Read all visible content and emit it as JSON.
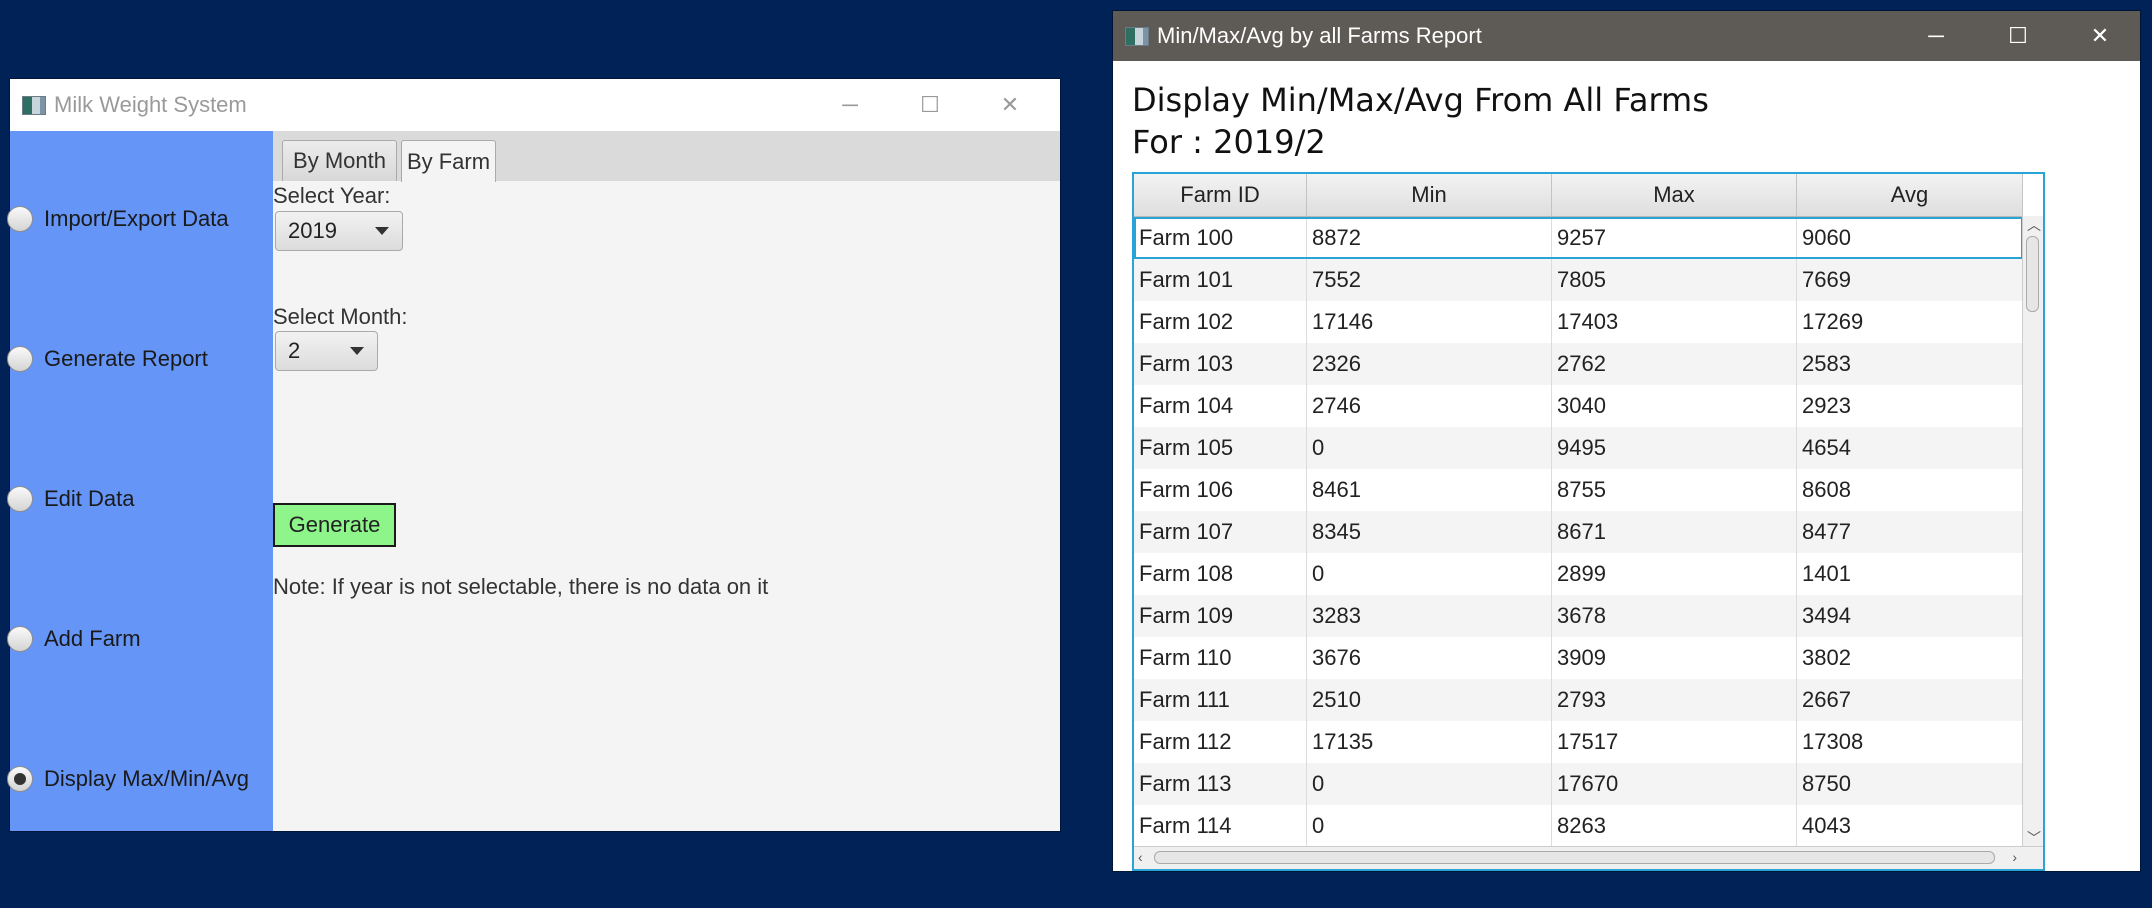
{
  "main_window": {
    "title": "Milk Weight System",
    "controls": {
      "minimize": "─",
      "maximize": "☐",
      "close": "✕"
    },
    "sidebar": {
      "items": [
        {
          "label": "Import/Export Data",
          "selected": false
        },
        {
          "label": "Generate Report",
          "selected": false
        },
        {
          "label": "Edit Data",
          "selected": false
        },
        {
          "label": "Add Farm",
          "selected": false
        },
        {
          "label": "Display Max/Min/Avg",
          "selected": true
        }
      ]
    },
    "tabs": [
      {
        "label": "By Month",
        "selected": false
      },
      {
        "label": "By Farm",
        "selected": true
      }
    ],
    "form": {
      "year_label": "Select Year:",
      "year_value": "2019",
      "month_label": "Select Month:",
      "month_value": "2",
      "generate_label": "Generate",
      "note": "Note: If year is not selectable, there is no data on it"
    },
    "colors": {
      "sidebar": "#6495f7",
      "generate_button": "#8df58a"
    }
  },
  "report_window": {
    "title": "Min/Max/Avg by all Farms Report",
    "controls": {
      "minimize": "─",
      "maximize": "☐",
      "close": "✕"
    },
    "heading_line1": "Display Min/Max/Avg From All Farms",
    "heading_line2": "For : 2019/2",
    "table": {
      "columns": [
        "Farm ID",
        "Min",
        "Max",
        "Avg"
      ],
      "rows": [
        [
          "Farm 100",
          "8872",
          "9257",
          "9060"
        ],
        [
          "Farm 101",
          "7552",
          "7805",
          "7669"
        ],
        [
          "Farm 102",
          "17146",
          "17403",
          "17269"
        ],
        [
          "Farm 103",
          "2326",
          "2762",
          "2583"
        ],
        [
          "Farm 104",
          "2746",
          "3040",
          "2923"
        ],
        [
          "Farm 105",
          "0",
          "9495",
          "4654"
        ],
        [
          "Farm 106",
          "8461",
          "8755",
          "8608"
        ],
        [
          "Farm 107",
          "8345",
          "8671",
          "8477"
        ],
        [
          "Farm 108",
          "0",
          "2899",
          "1401"
        ],
        [
          "Farm 109",
          "3283",
          "3678",
          "3494"
        ],
        [
          "Farm 110",
          "3676",
          "3909",
          "3802"
        ],
        [
          "Farm 111",
          "2510",
          "2793",
          "2667"
        ],
        [
          "Farm 112",
          "17135",
          "17517",
          "17308"
        ],
        [
          "Farm 113",
          "0",
          "17670",
          "8750"
        ],
        [
          "Farm 114",
          "0",
          "8263",
          "4043"
        ]
      ]
    },
    "colors": {
      "titlebar": "#5e5a55",
      "table_focus": "#2aa3d6"
    }
  },
  "desktop": {
    "background": "#002256"
  }
}
